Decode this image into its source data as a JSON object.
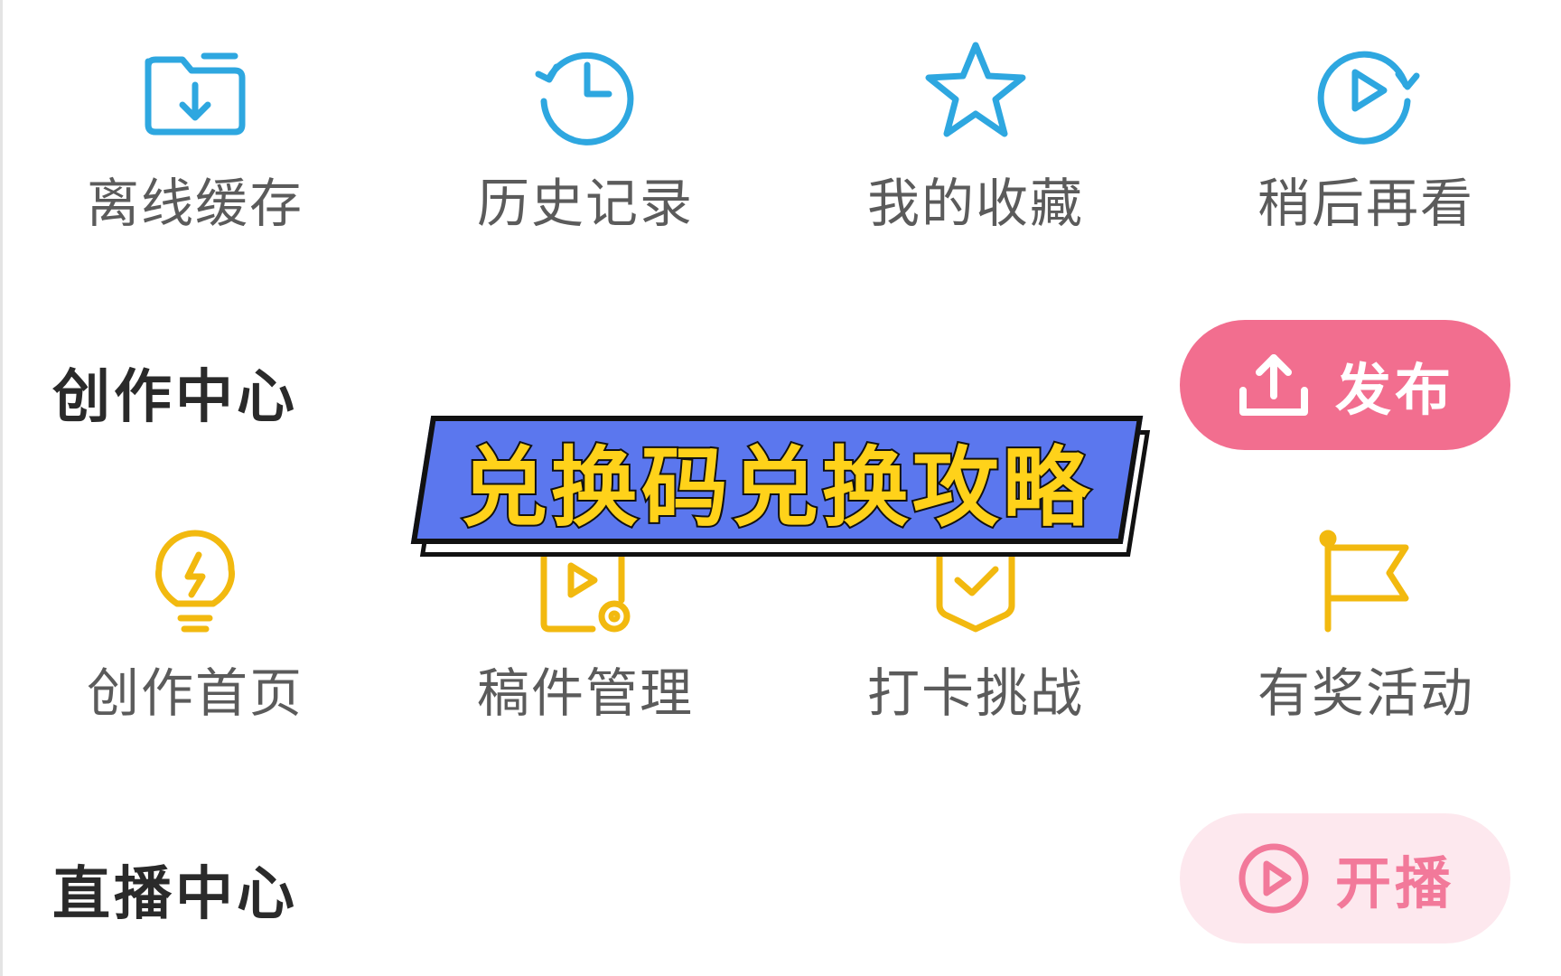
{
  "quick_actions": [
    {
      "label": "离线缓存",
      "icon": "download-folder-icon"
    },
    {
      "label": "历史记录",
      "icon": "history-clock-icon"
    },
    {
      "label": "我的收藏",
      "icon": "star-icon"
    },
    {
      "label": "稍后再看",
      "icon": "watch-later-icon"
    }
  ],
  "creation_center": {
    "title": "创作中心",
    "publish_button": {
      "label": "发布",
      "icon": "upload-icon"
    },
    "items": [
      {
        "label": "创作首页",
        "icon": "lightbulb-icon"
      },
      {
        "label": "稿件管理",
        "icon": "manuscript-icon"
      },
      {
        "label": "打卡挑战",
        "icon": "checkin-badge-icon"
      },
      {
        "label": "有奖活动",
        "icon": "flag-icon"
      }
    ]
  },
  "live_center": {
    "title": "直播中心",
    "go_live_button": {
      "label": "开播",
      "icon": "play-circle-icon"
    }
  },
  "overlay_banner": {
    "text": "兑换码兑换攻略"
  },
  "colors": {
    "blue_icon": "#2ea7e0",
    "yellow_icon": "#f2b90f",
    "pink_accent": "#f26e8f",
    "pink_light": "#fde8ee",
    "banner_blue": "#5b77ee",
    "banner_text": "#ffd21a"
  }
}
